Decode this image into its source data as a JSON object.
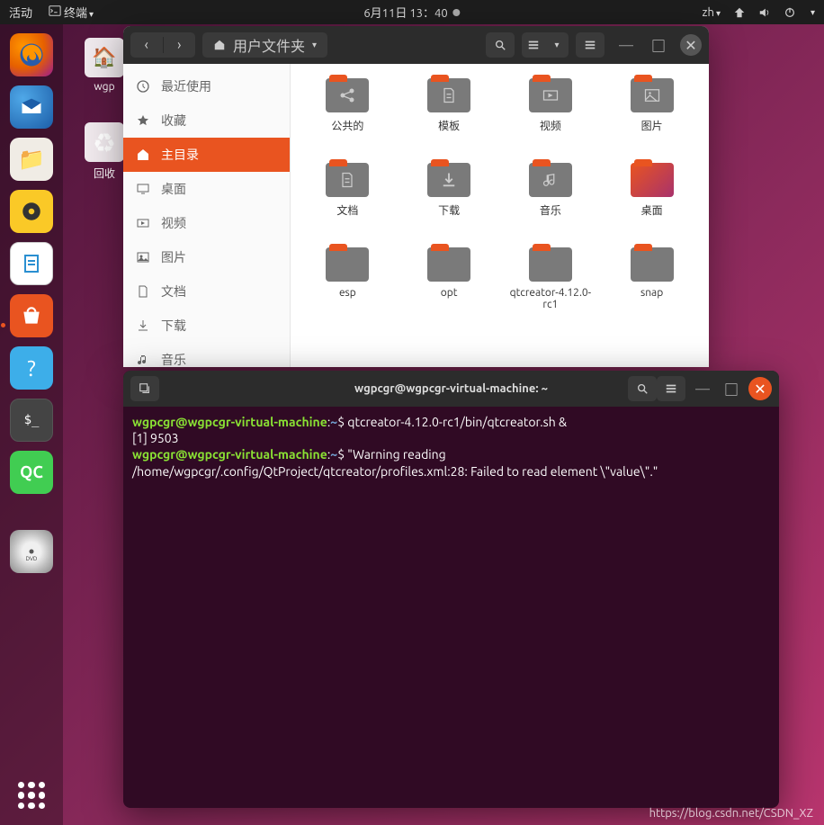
{
  "topbar": {
    "activities": "活动",
    "app": "终端",
    "datetime": "6月11日 13：40",
    "lang": "zh"
  },
  "desktop": {
    "icon1": "wgp",
    "icon2": "回收",
    "trash_glyph": "♻"
  },
  "dock": {
    "files_glyph": "📁",
    "rhythm_glyph": "🎵",
    "office_glyph": "📄",
    "store_glyph": "A",
    "help_glyph": "?",
    "term_glyph": "$_",
    "qc_glyph": "QC",
    "dvd_glyph": "✦"
  },
  "files": {
    "path_label": "用户文件夹",
    "sidebar": [
      {
        "label": "最近使用"
      },
      {
        "label": "收藏"
      },
      {
        "label": "主目录"
      },
      {
        "label": "桌面"
      },
      {
        "label": "视频"
      },
      {
        "label": "图片"
      },
      {
        "label": "文档"
      },
      {
        "label": "下载"
      },
      {
        "label": "音乐"
      }
    ],
    "folders": [
      {
        "name": "公共的",
        "icon": "share"
      },
      {
        "name": "模板",
        "icon": "doc"
      },
      {
        "name": "视频",
        "icon": "video"
      },
      {
        "name": "图片",
        "icon": "image"
      },
      {
        "name": "文档",
        "icon": "doc"
      },
      {
        "name": "下载",
        "icon": "download"
      },
      {
        "name": "音乐",
        "icon": "music"
      },
      {
        "name": "桌面",
        "icon": "desktop"
      },
      {
        "name": "esp",
        "icon": "none"
      },
      {
        "name": "opt",
        "icon": "none"
      },
      {
        "name": "qtcreator-4.12.0-rc1",
        "icon": "none"
      },
      {
        "name": "snap",
        "icon": "none"
      }
    ]
  },
  "terminal": {
    "title": "wgpcgr@wgpcgr-virtual-machine: ~",
    "prompt_user": "wgpcgr@wgpcgr-virtual-machine",
    "prompt_path": "~",
    "cmd1": "qtcreator-4.12.0-rc1/bin/qtcreator.sh &",
    "job": "[1] 9503",
    "err": "\"Warning reading /home/wgpcgr/.config/QtProject/qtcreator/profiles.xml:28: Failed to read element \\\"value\\\".\""
  },
  "watermark": "https://blog.csdn.net/CSDN_XZ"
}
